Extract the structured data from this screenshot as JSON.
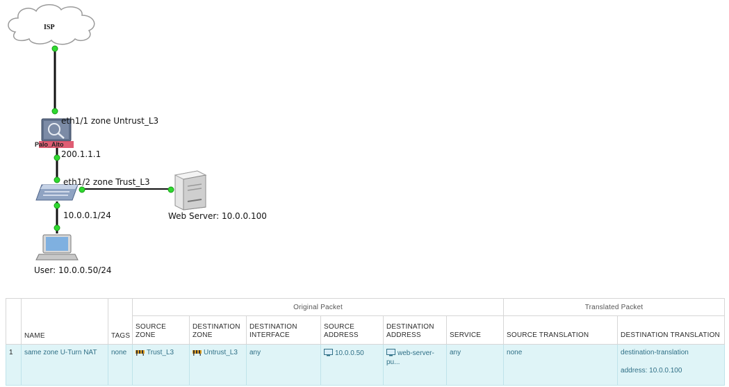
{
  "topology": {
    "isp_label": "ISP",
    "firewall_label": "Palo_Alto",
    "untrust_link": {
      "line1": "eth1/1 zone Untrust_L3",
      "line2": "200.1.1.1"
    },
    "trust_link": {
      "line1": "eth1/2 zone Trust_L3",
      "line2": "10.0.0.1/24"
    },
    "web_server_label": "Web Server: 10.0.0.100",
    "user_label": "User: 10.0.0.50/24",
    "colors": {
      "link_dot": "#2fd92f",
      "link_line": "#111111",
      "firewall_accent": "#d9415a"
    }
  },
  "nat_table": {
    "group_headers": {
      "original": "Original Packet",
      "translated": "Translated Packet"
    },
    "columns": {
      "name": "NAME",
      "tags": "TAGS",
      "source_zone": "SOURCE ZONE",
      "destination_zone": "DESTINATION ZONE",
      "destination_interface": "DESTINATION INTERFACE",
      "source_address": "SOURCE ADDRESS",
      "destination_address": "DESTINATION ADDRESS",
      "service": "SERVICE",
      "source_translation": "SOURCE TRANSLATION",
      "destination_translation": "DESTINATION TRANSLATION"
    },
    "rows": [
      {
        "index": "1",
        "name": "same zone U-Turn NAT",
        "tags": "none",
        "source_zone": "Trust_L3",
        "destination_zone": "Untrust_L3",
        "destination_interface": "any",
        "source_address": "10.0.0.50",
        "destination_address": "web-server-pu...",
        "service": "any",
        "source_translation": "none",
        "destination_translation": "destination-translation",
        "destination_translation_address": "address: 10.0.0.100"
      }
    ],
    "colors": {
      "row_bg": "#dff4f7",
      "row_text": "#2f6f86"
    }
  }
}
